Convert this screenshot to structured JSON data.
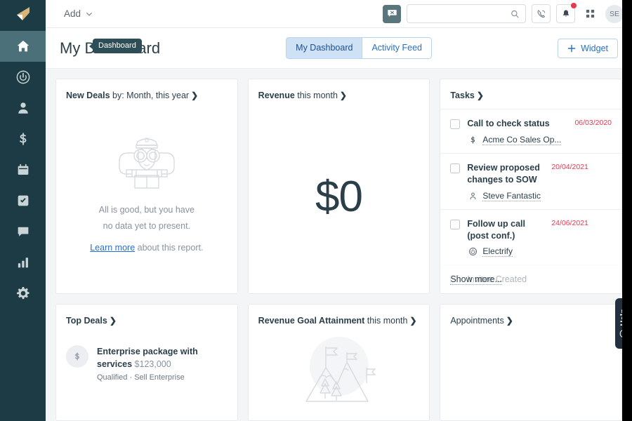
{
  "brand": {
    "logo_icon": "flag-logo-icon",
    "logo_color": "#d8b477",
    "sidebar_color": "#1d3b44",
    "accent_link": "#2a6fc4",
    "date_alert": "#e8384f"
  },
  "sidebar": {
    "items": [
      {
        "label": "Dashboard",
        "icon": "home-icon",
        "active": true
      },
      {
        "label": "Activity",
        "icon": "power-icon",
        "active": false
      },
      {
        "label": "Contacts",
        "icon": "person-icon",
        "active": false
      },
      {
        "label": "Deals",
        "icon": "dollar-icon",
        "active": false
      },
      {
        "label": "Calendar",
        "icon": "calendar-icon",
        "active": false
      },
      {
        "label": "Tasks",
        "icon": "checkbox-icon",
        "active": false
      },
      {
        "label": "Messages",
        "icon": "chat-icon",
        "active": false
      },
      {
        "label": "Reports",
        "icon": "bar-chart-icon",
        "active": false
      },
      {
        "label": "Settings",
        "icon": "gear-icon",
        "active": false
      }
    ],
    "tooltip": "Dashboard"
  },
  "topbar": {
    "add_label": "Add",
    "add_caret_icon": "chevron-down-icon",
    "message_icon": "message-box-icon",
    "search": {
      "value": "",
      "placeholder": "",
      "icon": "search-icon"
    },
    "phone_icon": "phone-icon",
    "bell_icon": "bell-icon",
    "bell_has_badge": true,
    "apps_icon": "grid-apps-icon",
    "avatar_initials": "SE"
  },
  "page": {
    "title": "My Dashboard",
    "tabs": [
      {
        "label": "My Dashboard",
        "active": true
      },
      {
        "label": "Activity Feed",
        "active": false
      }
    ],
    "widget_button": {
      "label": "Widget",
      "icon": "plus-icon"
    }
  },
  "cards": {
    "new_deals": {
      "title": "New Deals",
      "subtitle": " by: Month, this year",
      "chevron": "❯",
      "illustration": "sailor-binoculars-icon",
      "empty_line1": "All is good, but you have",
      "empty_line2": "no data yet to present.",
      "link_text": "Learn more",
      "link_tail": " about this report."
    },
    "revenue": {
      "title": "Revenue",
      "subtitle": " this month",
      "chevron": "❯",
      "value": "$0"
    },
    "tasks": {
      "title": "Tasks",
      "subtitle": "",
      "chevron": "❯",
      "items": [
        {
          "title": "Call to check status",
          "date": "06/03/2020",
          "related": "Acme Co Sales Op...",
          "related_icon": "dollar-icon",
          "checked": false,
          "faded": false
        },
        {
          "title": "Review proposed changes to SOW",
          "date": "20/04/2021",
          "related": "Steve Fantastic",
          "related_icon": "person-icon",
          "checked": false,
          "faded": false
        },
        {
          "title": "Follow up call (post conf.)",
          "date": "24/06/2021",
          "related": "Electrify",
          "related_icon": "power-icon",
          "checked": false,
          "faded": false
        },
        {
          "title": "Invitee Created",
          "date": "",
          "related": "",
          "related_icon": "",
          "checked": false,
          "faded": true
        }
      ],
      "show_more": "Show more..."
    },
    "top_deals": {
      "title": "Top Deals",
      "subtitle": "",
      "chevron": "❯",
      "deals": [
        {
          "avatar_icon": "dollar-icon",
          "name": "Enterprise package with services",
          "amount": "$123,000",
          "meta": "Qualified · Sell Enterprise"
        }
      ]
    },
    "revenue_goal": {
      "title": "Revenue Goal Attainment",
      "subtitle": " this month",
      "chevron": "❯",
      "illustration": "mountain-flags-icon"
    },
    "appointments": {
      "title": "Appointments",
      "subtitle": "",
      "chevron": "❯"
    }
  },
  "help": {
    "label": "Help",
    "icon": "question-circle-icon"
  }
}
